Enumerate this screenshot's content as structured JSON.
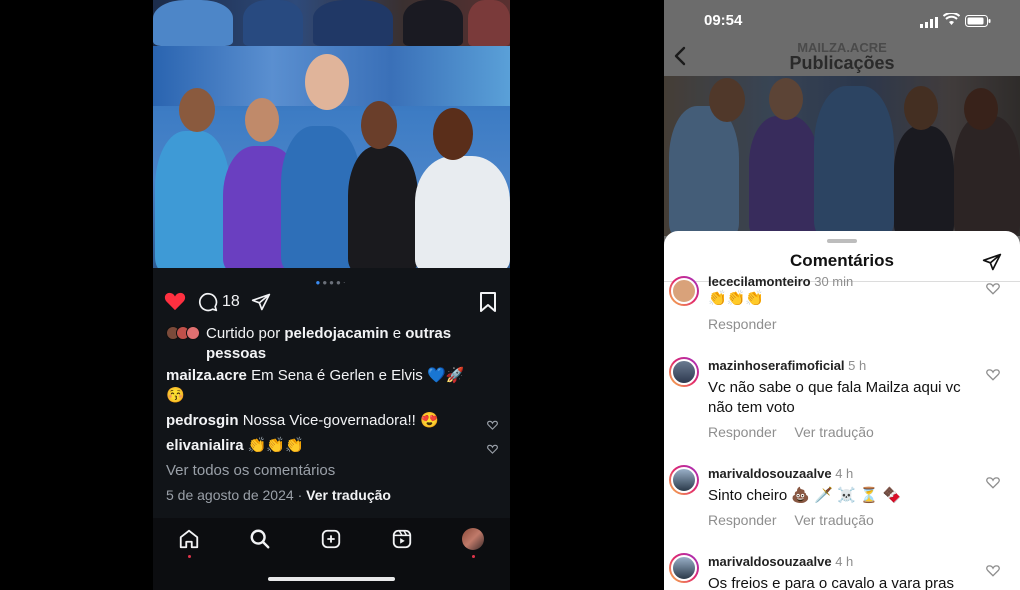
{
  "left_post": {
    "pagination_dots": "● ● ● ● ·",
    "comment_count": "18",
    "liked_by_prefix": "Curtido por",
    "liked_by_user": "peledojacamin",
    "liked_by_and": "e",
    "liked_by_others": "outras pessoas",
    "caption_user": "mailza.acre",
    "caption_text": "Em Sena é Gerlen e Elvis 💙🚀",
    "caption_emoji": "😚",
    "comments": [
      {
        "user": "pedrosgin",
        "text": "Nossa Vice-governadora!! 😍"
      },
      {
        "user": "elivanialira",
        "text": "👏👏👏"
      }
    ],
    "view_all": "Ver todos os comentários",
    "date": "5 de agosto de 2024",
    "date_sep": "·",
    "translate": "Ver tradução"
  },
  "right_panel": {
    "status": {
      "time": "09:54"
    },
    "header": {
      "username": "MAILZA.ACRE",
      "title": "Publicações"
    },
    "sheet_title": "Comentários",
    "comments": [
      {
        "user": "lececilamonteiro",
        "time": "30 min",
        "text": "👏👏👏",
        "actions": [
          "Responder"
        ]
      },
      {
        "user": "mazinhoserafimoficial",
        "time": "5 h",
        "text": "Vc não sabe o que fala  Mailza aqui vc não tem voto",
        "actions": [
          "Responder",
          "Ver tradução"
        ]
      },
      {
        "user": "marivaldosouzaalve",
        "time": "4 h",
        "text": "Sinto cheiro 💩 🗡️ ☠️ ⏳ 🍫",
        "actions": [
          "Responder",
          "Ver tradução"
        ]
      },
      {
        "user": "marivaldosouzaalve",
        "time": "4 h",
        "text": "Os freios e para o cavalo a vara pras",
        "actions": []
      }
    ]
  },
  "colors": {
    "accent_red": "#ff3040",
    "link_blue": "#3a8bf0",
    "dark_bg": "#111418"
  }
}
